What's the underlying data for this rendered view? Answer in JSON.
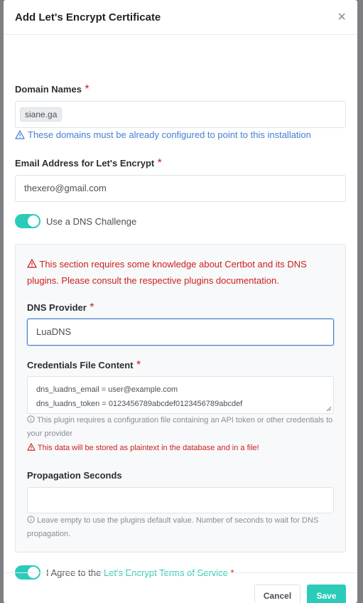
{
  "modal": {
    "title": "Add Let's Encrypt Certificate",
    "close_glyph": "×"
  },
  "domain_names": {
    "label": "Domain Names",
    "required": "*",
    "value_pill": "siane.ga",
    "hint": "These domains must be already configured to point to this installation"
  },
  "email": {
    "label": "Email Address for Let's Encrypt",
    "required": "*",
    "value": "thexero@gmail.com"
  },
  "dns_challenge": {
    "label": "Use a DNS Challenge",
    "enabled": true
  },
  "dns_section": {
    "warning": "This section requires some knowledge about Certbot and its DNS plugins. Please consult the respective plugins documentation.",
    "provider_label": "DNS Provider",
    "provider_required": "*",
    "provider_value": "LuaDNS",
    "credentials_label": "Credentials File Content",
    "credentials_required": "*",
    "credentials_line1": "dns_luadns_email = user@example.com",
    "credentials_line2": "dns_luadns_token = 0123456789abcdef0123456789abcdef",
    "credentials_info": "This plugin requires a configuration file containing an API token or other credentials to your provider",
    "credentials_warning": "This data will be stored as plaintext in the database and in a file!",
    "propagation_label": "Propagation Seconds",
    "propagation_value": "",
    "propagation_info": "Leave empty to use the plugins default value. Number of seconds to wait for DNS propagation."
  },
  "agree": {
    "label_prefix": "I Agree to the",
    "link_text": "Let's Encrypt Terms of Service",
    "required": "*",
    "enabled": true
  },
  "footer": {
    "cancel_label": "Cancel",
    "save_label": "Save"
  },
  "colors": {
    "accent": "#2bcbba",
    "danger": "#cd201f",
    "info": "#467fcf"
  }
}
